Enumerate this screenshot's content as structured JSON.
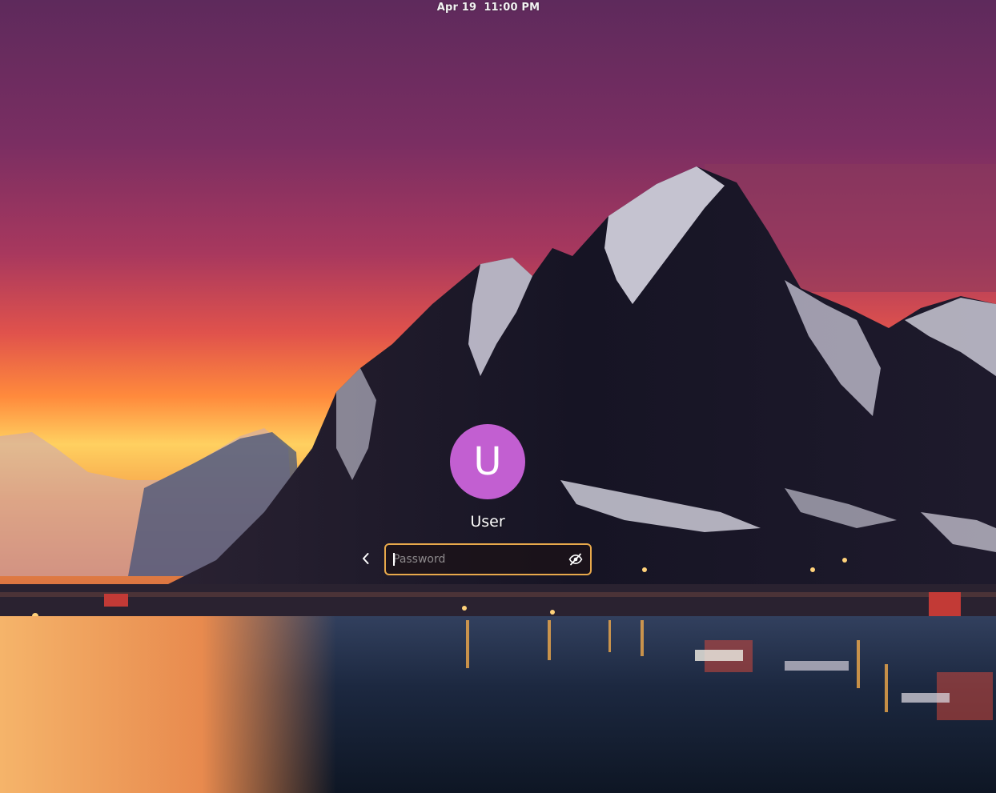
{
  "topbar": {
    "date": "Apr 19",
    "time": "11:00 PM"
  },
  "user": {
    "initial": "U",
    "name": "User",
    "avatar_color": "#c25fd1"
  },
  "password": {
    "placeholder": "Password",
    "value": ""
  },
  "icons": {
    "back": "chevron-left-icon",
    "reveal": "eye-slash-icon"
  },
  "colors": {
    "focus_border": "#e8a94b",
    "sky_top": "#6a2a5a",
    "sky_glow": "#ff7a3a",
    "mountain": "#1c1a2c",
    "water": "#1e2a40"
  }
}
